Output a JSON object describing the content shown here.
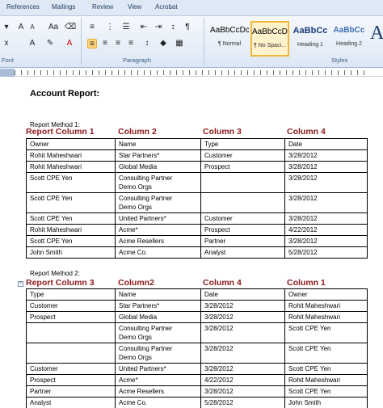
{
  "ribbon": {
    "tabs": [
      "References",
      "Mailings",
      "Review",
      "View",
      "Acrobat"
    ],
    "groups": {
      "font": "Font",
      "paragraph": "Paragraph",
      "styles": "Styles"
    },
    "styles": [
      {
        "sample": "AaBbCcDc",
        "name": "¶ Normal"
      },
      {
        "sample": "AaBbCcDc",
        "name": "¶ No Spaci..."
      },
      {
        "sample": "AaBbCc",
        "name": "Heading 1"
      },
      {
        "sample": "AaBbCc",
        "name": "Heading 2"
      }
    ],
    "big_style_glyph": "A",
    "icons": [
      "bullets-icon",
      "numbering-icon",
      "align-left-icon",
      "center-icon",
      "align-right-icon",
      "justify-icon",
      "line-spacing-icon",
      "shading-icon",
      "borders-icon",
      "sort-icon",
      "pilcrow-icon"
    ]
  },
  "document": {
    "title": "Account Report:",
    "method1": {
      "label": "Report Method 1:",
      "col_headings": [
        "Report Column 1",
        "Column 2",
        "Column 3",
        "Column 4"
      ],
      "rows": [
        [
          "Owner",
          "Name",
          "Type",
          "Date"
        ],
        [
          "Rohit Maheshwari",
          "Star Partners*",
          "Customer",
          "3/28/2012"
        ],
        [
          "Rohit Maheshwari",
          "Global Media",
          "Prospect",
          "3/28/2012"
        ],
        [
          "Scott CPE Yen",
          "Consulting Partner\nDemo Orgs",
          "",
          "3/28/2012"
        ],
        [
          "Scott CPE Yen",
          "Consulting Partner\nDemo Orgs",
          "",
          "3/28/2012"
        ],
        [
          "Scott CPE Yen",
          "United Partners*",
          "Customer",
          "3/28/2012"
        ],
        [
          "Rohit Maheshwari",
          "Acme*",
          "Prospect",
          "4/22/2012"
        ],
        [
          "Scott CPE Yen",
          "Acme Resellers",
          "Partner",
          "3/28/2012"
        ],
        [
          "John Smith",
          "Acme Co.",
          "Analyst",
          "5/28/2012"
        ]
      ]
    },
    "method2": {
      "label": "Report Method 2:",
      "col_headings": [
        "Report Column 3",
        "Column2",
        "Column 4",
        "Column 1"
      ],
      "rows": [
        [
          "Type",
          "Name",
          "Date",
          "Owner"
        ],
        [
          "Customer",
          "Star Partners*",
          "3/28/2012",
          "Rohit Maheshwari"
        ],
        [
          "Prospect",
          "Global Media",
          "3/28/2012",
          "Rohit Maheshwari"
        ],
        [
          "",
          "Consulting Partner\nDemo Orgs",
          "3/28/2012",
          "Scott CPE Yen"
        ],
        [
          "",
          "Consulting Partner\nDemo Orgs",
          "3/28/2012",
          "Scott CPE Yen"
        ],
        [
          "Customer",
          "United Partners*",
          "3/28/2012",
          "Scott CPE Yen"
        ],
        [
          "Prospect",
          "Acme*",
          "4/22/2012",
          "Rohit Maheshwari"
        ],
        [
          "Partner",
          "Acme Resellers",
          "3/28/2012",
          "Scott CPE Yen"
        ],
        [
          "Analyst",
          "Acme Co.",
          "5/28/2012",
          "John Smith"
        ]
      ]
    }
  }
}
